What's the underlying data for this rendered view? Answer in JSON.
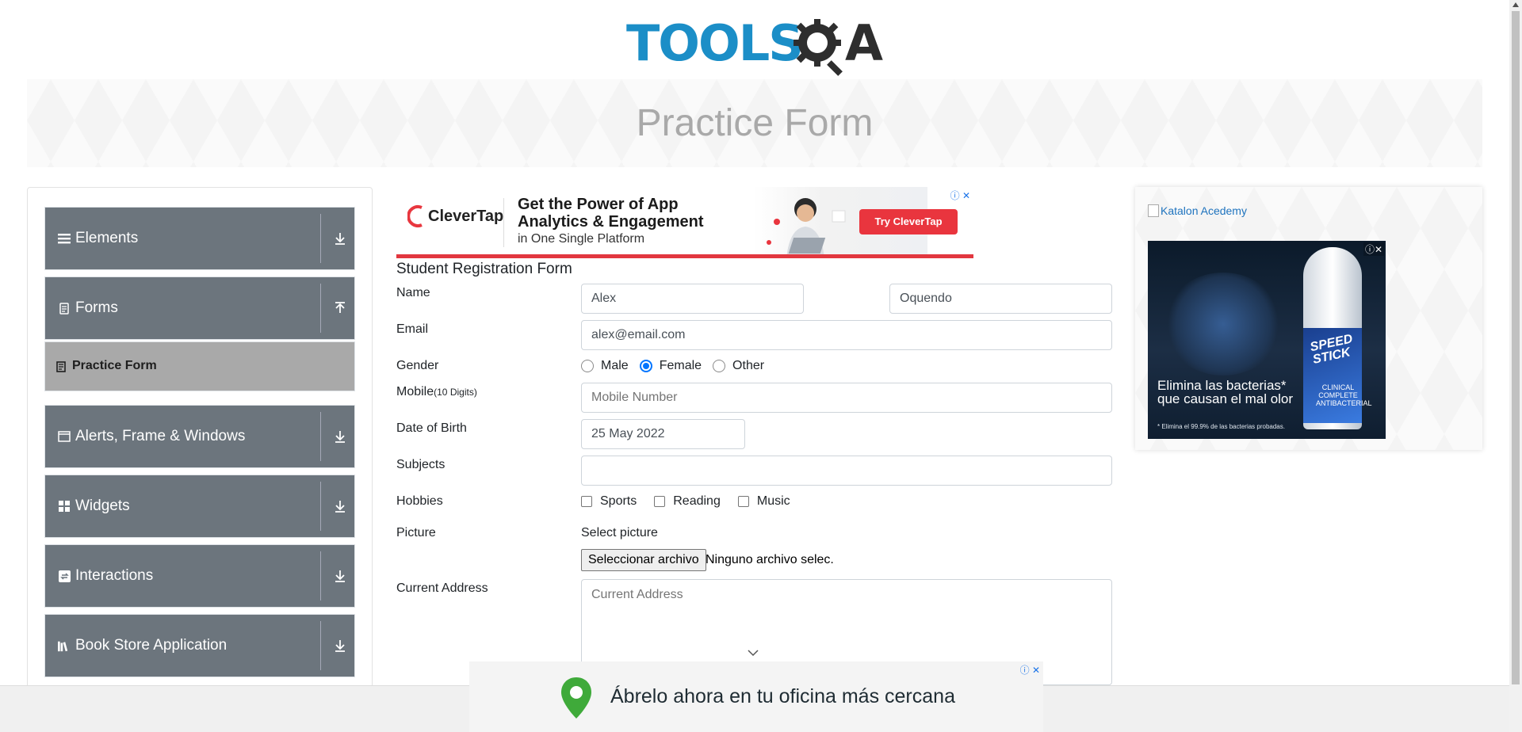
{
  "header": {
    "logo_main": "TOOLS",
    "logo_a": "A",
    "page_title": "Practice Form"
  },
  "sidebar": {
    "groups": [
      {
        "label": "Elements",
        "icon": "hamburger-icon",
        "expanded": false
      },
      {
        "label": "Forms",
        "icon": "document-icon",
        "expanded": true
      },
      {
        "label": "Alerts, Frame & Windows",
        "icon": "window-icon",
        "expanded": false
      },
      {
        "label": "Widgets",
        "icon": "grid-icon",
        "expanded": false
      },
      {
        "label": "Interactions",
        "icon": "interaction-icon",
        "expanded": false
      },
      {
        "label": "Book Store Application",
        "icon": "books-icon",
        "expanded": false
      }
    ],
    "active_item": "Practice Form",
    "group_bg": "#6c757d",
    "active_bg": "#a9a9a9"
  },
  "ad_top": {
    "brand": "CleverTap",
    "headline_1": "Get the Power of App",
    "headline_2": "Analytics & Engagement",
    "subline": "in One Single Platform",
    "cta": "Try CleverTap"
  },
  "form": {
    "title": "Student Registration Form",
    "labels": {
      "name": "Name",
      "email": "Email",
      "gender": "Gender",
      "mobile": "Mobile",
      "mobile_hint": "(10 Digits)",
      "dob": "Date of Birth",
      "subjects": "Subjects",
      "hobbies": "Hobbies",
      "picture": "Picture",
      "address": "Current Address"
    },
    "first_name": "Alex",
    "last_name": "Oquendo",
    "email": "alex@email.com",
    "gender_options": [
      "Male",
      "Female",
      "Other"
    ],
    "gender_selected": "Female",
    "mobile_placeholder": "Mobile Number",
    "dob": "25 May 2022",
    "subjects": "",
    "hobbies": [
      "Sports",
      "Reading",
      "Music"
    ],
    "picture_label": "Select picture",
    "file_button": "Seleccionar archivo",
    "file_status": "Ninguno archivo selec.",
    "address_placeholder": "Current Address"
  },
  "ad_right": {
    "link_text": "Katalon Acedemy",
    "brand": "SPEED STICK",
    "product": "CLINICAL COMPLETE ANTIBACTERIAL",
    "headline": "Elimina las bacterias* que causan el mal olor",
    "fine_print": "* Elimina el 99.9% de las bacterias probadas."
  },
  "ad_bottom": {
    "text": "Ábrelo ahora en tu oficina más cercana"
  }
}
